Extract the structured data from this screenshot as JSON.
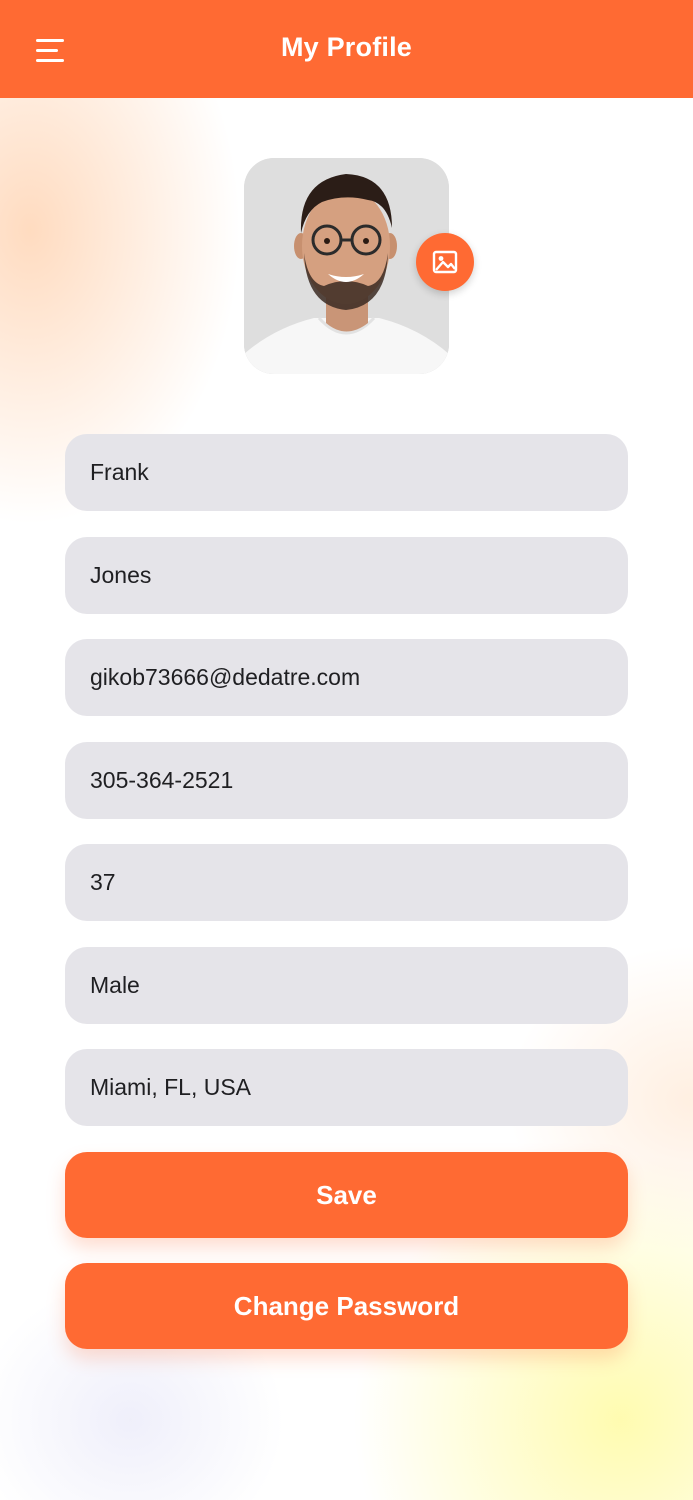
{
  "header": {
    "title": "My Profile",
    "menu_icon": "menu-icon",
    "color": "#ff6a33"
  },
  "profile": {
    "avatar_icon": "profile-photo",
    "photo_button_icon": "image-icon"
  },
  "form": {
    "first_name": "Frank",
    "last_name": "Jones",
    "email": "gikob73666@dedatre.com",
    "phone": "305-364-2521",
    "age": "37",
    "gender": "Male",
    "location": "Miami, FL, USA"
  },
  "actions": {
    "save_label": "Save",
    "change_password_label": "Change Password"
  },
  "colors": {
    "accent": "#ff6a33",
    "field_bg": "#e5e4e9"
  }
}
